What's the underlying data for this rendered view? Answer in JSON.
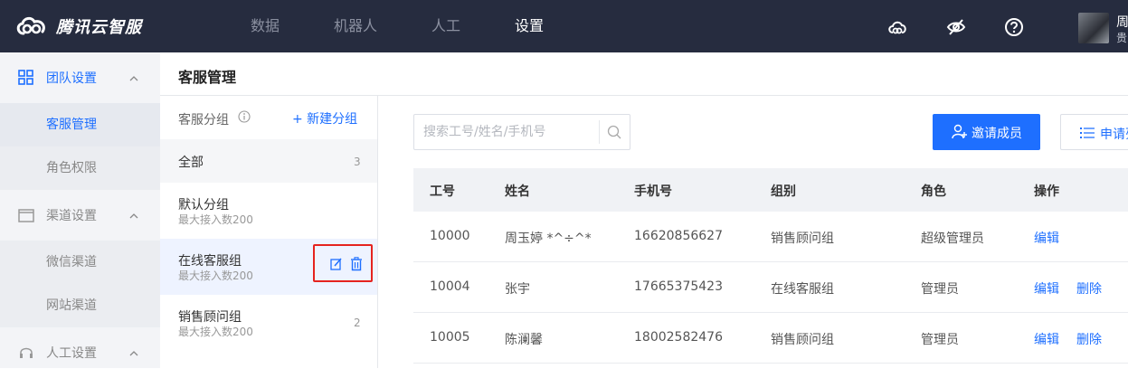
{
  "app": {
    "name": "腾讯云智服"
  },
  "topnav": [
    {
      "label": "数据",
      "active": false
    },
    {
      "label": "机器人",
      "active": false
    },
    {
      "label": "人工",
      "active": false
    },
    {
      "label": "设置",
      "active": true
    }
  ],
  "user": {
    "name": "周",
    "role": "贵"
  },
  "sidebar": {
    "sections": [
      {
        "label": "团队设置",
        "icon": "grid-icon",
        "active": true,
        "items": [
          {
            "label": "客服管理",
            "active": true
          },
          {
            "label": "角色权限",
            "active": false
          }
        ]
      },
      {
        "label": "渠道设置",
        "icon": "window-icon",
        "active": false,
        "items": [
          {
            "label": "微信渠道",
            "active": false
          },
          {
            "label": "网站渠道",
            "active": false
          }
        ]
      },
      {
        "label": "人工设置",
        "icon": "headset-icon",
        "active": false,
        "items": []
      }
    ]
  },
  "page": {
    "title": "客服管理"
  },
  "groups": {
    "header_label": "客服分组",
    "new_label": "+ 新建分组",
    "items": [
      {
        "name": "全部",
        "sub": "",
        "count": "3"
      },
      {
        "name": "默认分组",
        "sub": "最大接入数200",
        "count": ""
      },
      {
        "name": "在线客服组",
        "sub": "最大接入数200",
        "count": ""
      },
      {
        "name": "销售顾问组",
        "sub": "最大接入数200",
        "count": "2"
      }
    ]
  },
  "search": {
    "placeholder": "搜索工号/姓名/手机号"
  },
  "buttons": {
    "invite": "邀请成员",
    "apply": "申请列表"
  },
  "table": {
    "columns": [
      "工号",
      "姓名",
      "手机号",
      "组别",
      "角色",
      "操作"
    ],
    "rows": [
      {
        "id": "10000",
        "name": "周玉婷 *^÷^*",
        "phone": "16620856627",
        "group": "销售顾问组",
        "role": "超级管理员",
        "actions": [
          "编辑"
        ]
      },
      {
        "id": "10004",
        "name": "张宇",
        "phone": "17665375423",
        "group": "在线客服组",
        "role": "管理员",
        "actions": [
          "编辑",
          "删除"
        ]
      },
      {
        "id": "10005",
        "name": "陈澜馨",
        "phone": "18002582476",
        "group": "销售顾问组",
        "role": "管理员",
        "actions": [
          "编辑",
          "删除"
        ]
      }
    ]
  },
  "colors": {
    "topbar": "#262c3f",
    "accent": "#1e6fff",
    "highlight": "#e5231f"
  }
}
